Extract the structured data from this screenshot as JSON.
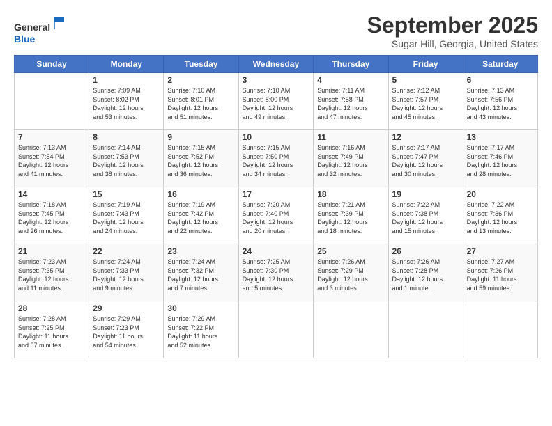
{
  "logo": {
    "line1": "General",
    "line2": "Blue"
  },
  "title": "September 2025",
  "location": "Sugar Hill, Georgia, United States",
  "days_of_week": [
    "Sunday",
    "Monday",
    "Tuesday",
    "Wednesday",
    "Thursday",
    "Friday",
    "Saturday"
  ],
  "weeks": [
    [
      {
        "day": "",
        "content": ""
      },
      {
        "day": "1",
        "content": "Sunrise: 7:09 AM\nSunset: 8:02 PM\nDaylight: 12 hours\nand 53 minutes."
      },
      {
        "day": "2",
        "content": "Sunrise: 7:10 AM\nSunset: 8:01 PM\nDaylight: 12 hours\nand 51 minutes."
      },
      {
        "day": "3",
        "content": "Sunrise: 7:10 AM\nSunset: 8:00 PM\nDaylight: 12 hours\nand 49 minutes."
      },
      {
        "day": "4",
        "content": "Sunrise: 7:11 AM\nSunset: 7:58 PM\nDaylight: 12 hours\nand 47 minutes."
      },
      {
        "day": "5",
        "content": "Sunrise: 7:12 AM\nSunset: 7:57 PM\nDaylight: 12 hours\nand 45 minutes."
      },
      {
        "day": "6",
        "content": "Sunrise: 7:13 AM\nSunset: 7:56 PM\nDaylight: 12 hours\nand 43 minutes."
      }
    ],
    [
      {
        "day": "7",
        "content": "Sunrise: 7:13 AM\nSunset: 7:54 PM\nDaylight: 12 hours\nand 41 minutes."
      },
      {
        "day": "8",
        "content": "Sunrise: 7:14 AM\nSunset: 7:53 PM\nDaylight: 12 hours\nand 38 minutes."
      },
      {
        "day": "9",
        "content": "Sunrise: 7:15 AM\nSunset: 7:52 PM\nDaylight: 12 hours\nand 36 minutes."
      },
      {
        "day": "10",
        "content": "Sunrise: 7:15 AM\nSunset: 7:50 PM\nDaylight: 12 hours\nand 34 minutes."
      },
      {
        "day": "11",
        "content": "Sunrise: 7:16 AM\nSunset: 7:49 PM\nDaylight: 12 hours\nand 32 minutes."
      },
      {
        "day": "12",
        "content": "Sunrise: 7:17 AM\nSunset: 7:47 PM\nDaylight: 12 hours\nand 30 minutes."
      },
      {
        "day": "13",
        "content": "Sunrise: 7:17 AM\nSunset: 7:46 PM\nDaylight: 12 hours\nand 28 minutes."
      }
    ],
    [
      {
        "day": "14",
        "content": "Sunrise: 7:18 AM\nSunset: 7:45 PM\nDaylight: 12 hours\nand 26 minutes."
      },
      {
        "day": "15",
        "content": "Sunrise: 7:19 AM\nSunset: 7:43 PM\nDaylight: 12 hours\nand 24 minutes."
      },
      {
        "day": "16",
        "content": "Sunrise: 7:19 AM\nSunset: 7:42 PM\nDaylight: 12 hours\nand 22 minutes."
      },
      {
        "day": "17",
        "content": "Sunrise: 7:20 AM\nSunset: 7:40 PM\nDaylight: 12 hours\nand 20 minutes."
      },
      {
        "day": "18",
        "content": "Sunrise: 7:21 AM\nSunset: 7:39 PM\nDaylight: 12 hours\nand 18 minutes."
      },
      {
        "day": "19",
        "content": "Sunrise: 7:22 AM\nSunset: 7:38 PM\nDaylight: 12 hours\nand 15 minutes."
      },
      {
        "day": "20",
        "content": "Sunrise: 7:22 AM\nSunset: 7:36 PM\nDaylight: 12 hours\nand 13 minutes."
      }
    ],
    [
      {
        "day": "21",
        "content": "Sunrise: 7:23 AM\nSunset: 7:35 PM\nDaylight: 12 hours\nand 11 minutes."
      },
      {
        "day": "22",
        "content": "Sunrise: 7:24 AM\nSunset: 7:33 PM\nDaylight: 12 hours\nand 9 minutes."
      },
      {
        "day": "23",
        "content": "Sunrise: 7:24 AM\nSunset: 7:32 PM\nDaylight: 12 hours\nand 7 minutes."
      },
      {
        "day": "24",
        "content": "Sunrise: 7:25 AM\nSunset: 7:30 PM\nDaylight: 12 hours\nand 5 minutes."
      },
      {
        "day": "25",
        "content": "Sunrise: 7:26 AM\nSunset: 7:29 PM\nDaylight: 12 hours\nand 3 minutes."
      },
      {
        "day": "26",
        "content": "Sunrise: 7:26 AM\nSunset: 7:28 PM\nDaylight: 12 hours\nand 1 minute."
      },
      {
        "day": "27",
        "content": "Sunrise: 7:27 AM\nSunset: 7:26 PM\nDaylight: 11 hours\nand 59 minutes."
      }
    ],
    [
      {
        "day": "28",
        "content": "Sunrise: 7:28 AM\nSunset: 7:25 PM\nDaylight: 11 hours\nand 57 minutes."
      },
      {
        "day": "29",
        "content": "Sunrise: 7:29 AM\nSunset: 7:23 PM\nDaylight: 11 hours\nand 54 minutes."
      },
      {
        "day": "30",
        "content": "Sunrise: 7:29 AM\nSunset: 7:22 PM\nDaylight: 11 hours\nand 52 minutes."
      },
      {
        "day": "",
        "content": ""
      },
      {
        "day": "",
        "content": ""
      },
      {
        "day": "",
        "content": ""
      },
      {
        "day": "",
        "content": ""
      }
    ]
  ]
}
